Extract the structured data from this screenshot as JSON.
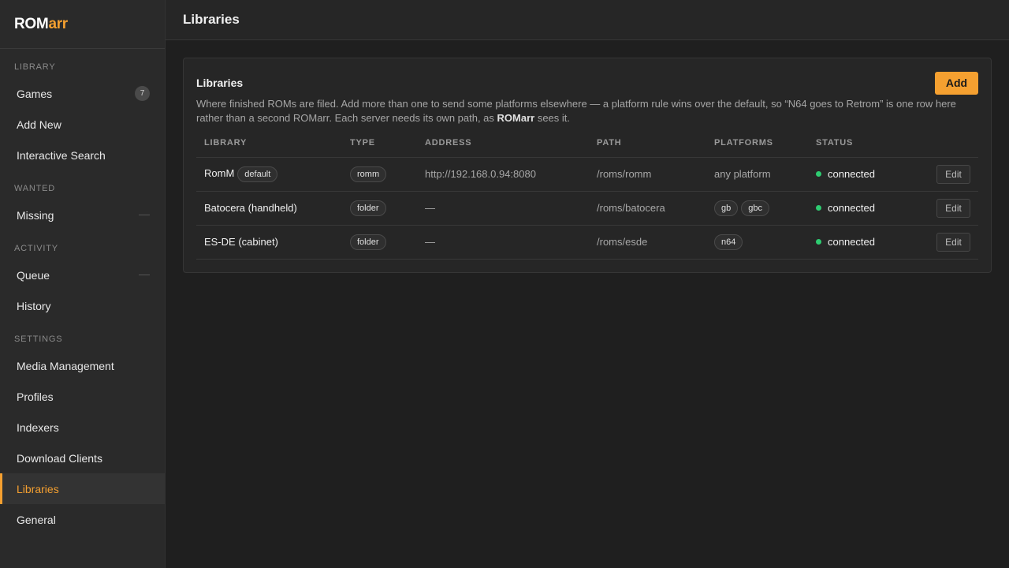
{
  "app": {
    "logo_primary": "ROM",
    "logo_accent": "arr",
    "accent_color": "#f5a030"
  },
  "sidebar": {
    "sections": [
      {
        "title": "LIBRARY",
        "items": [
          {
            "label": "Games",
            "badge": "7"
          },
          {
            "label": "Add New"
          },
          {
            "label": "Interactive Search"
          }
        ]
      },
      {
        "title": "WANTED",
        "items": [
          {
            "label": "Missing"
          }
        ]
      },
      {
        "title": "ACTIVITY",
        "items": [
          {
            "label": "Queue"
          },
          {
            "label": "History"
          }
        ]
      },
      {
        "title": "SETTINGS",
        "items": [
          {
            "label": "Media Management"
          },
          {
            "label": "Profiles"
          },
          {
            "label": "Indexers"
          },
          {
            "label": "Download Clients"
          },
          {
            "label": "Libraries",
            "active": true
          },
          {
            "label": "General"
          }
        ]
      }
    ]
  },
  "header": {
    "title": "Libraries"
  },
  "panel": {
    "title": "Libraries",
    "add_label": "Add",
    "description_part1": "Where finished ROMs are filed. Add more than one to send some platforms elsewhere — a platform rule wins over the default, so “N64 goes to Retrom” is one row here rather than a second ROMarr. Each server needs its own path, as ",
    "description_bold": "ROMarr",
    "description_part2": " sees it."
  },
  "table": {
    "columns": [
      "LIBRARY",
      "TYPE",
      "ADDRESS",
      "PATH",
      "PLATFORMS",
      "STATUS",
      ""
    ],
    "rows": [
      {
        "name": "RomM",
        "tag": "default",
        "type": "romm",
        "address": "http://192.168.0.94:8080",
        "path": "/roms/romm",
        "platforms_text": "any platform",
        "platforms": [],
        "status": "connected",
        "edit_label": "Edit"
      },
      {
        "name": "Batocera (handheld)",
        "tag": "",
        "type": "folder",
        "address": "—",
        "path": "/roms/batocera",
        "platforms_text": "",
        "platforms": [
          "gb",
          "gbc"
        ],
        "status": "connected",
        "edit_label": "Edit"
      },
      {
        "name": "ES-DE (cabinet)",
        "tag": "",
        "type": "folder",
        "address": "—",
        "path": "/roms/esde",
        "platforms_text": "",
        "platforms": [
          "n64"
        ],
        "status": "connected",
        "edit_label": "Edit"
      }
    ]
  }
}
